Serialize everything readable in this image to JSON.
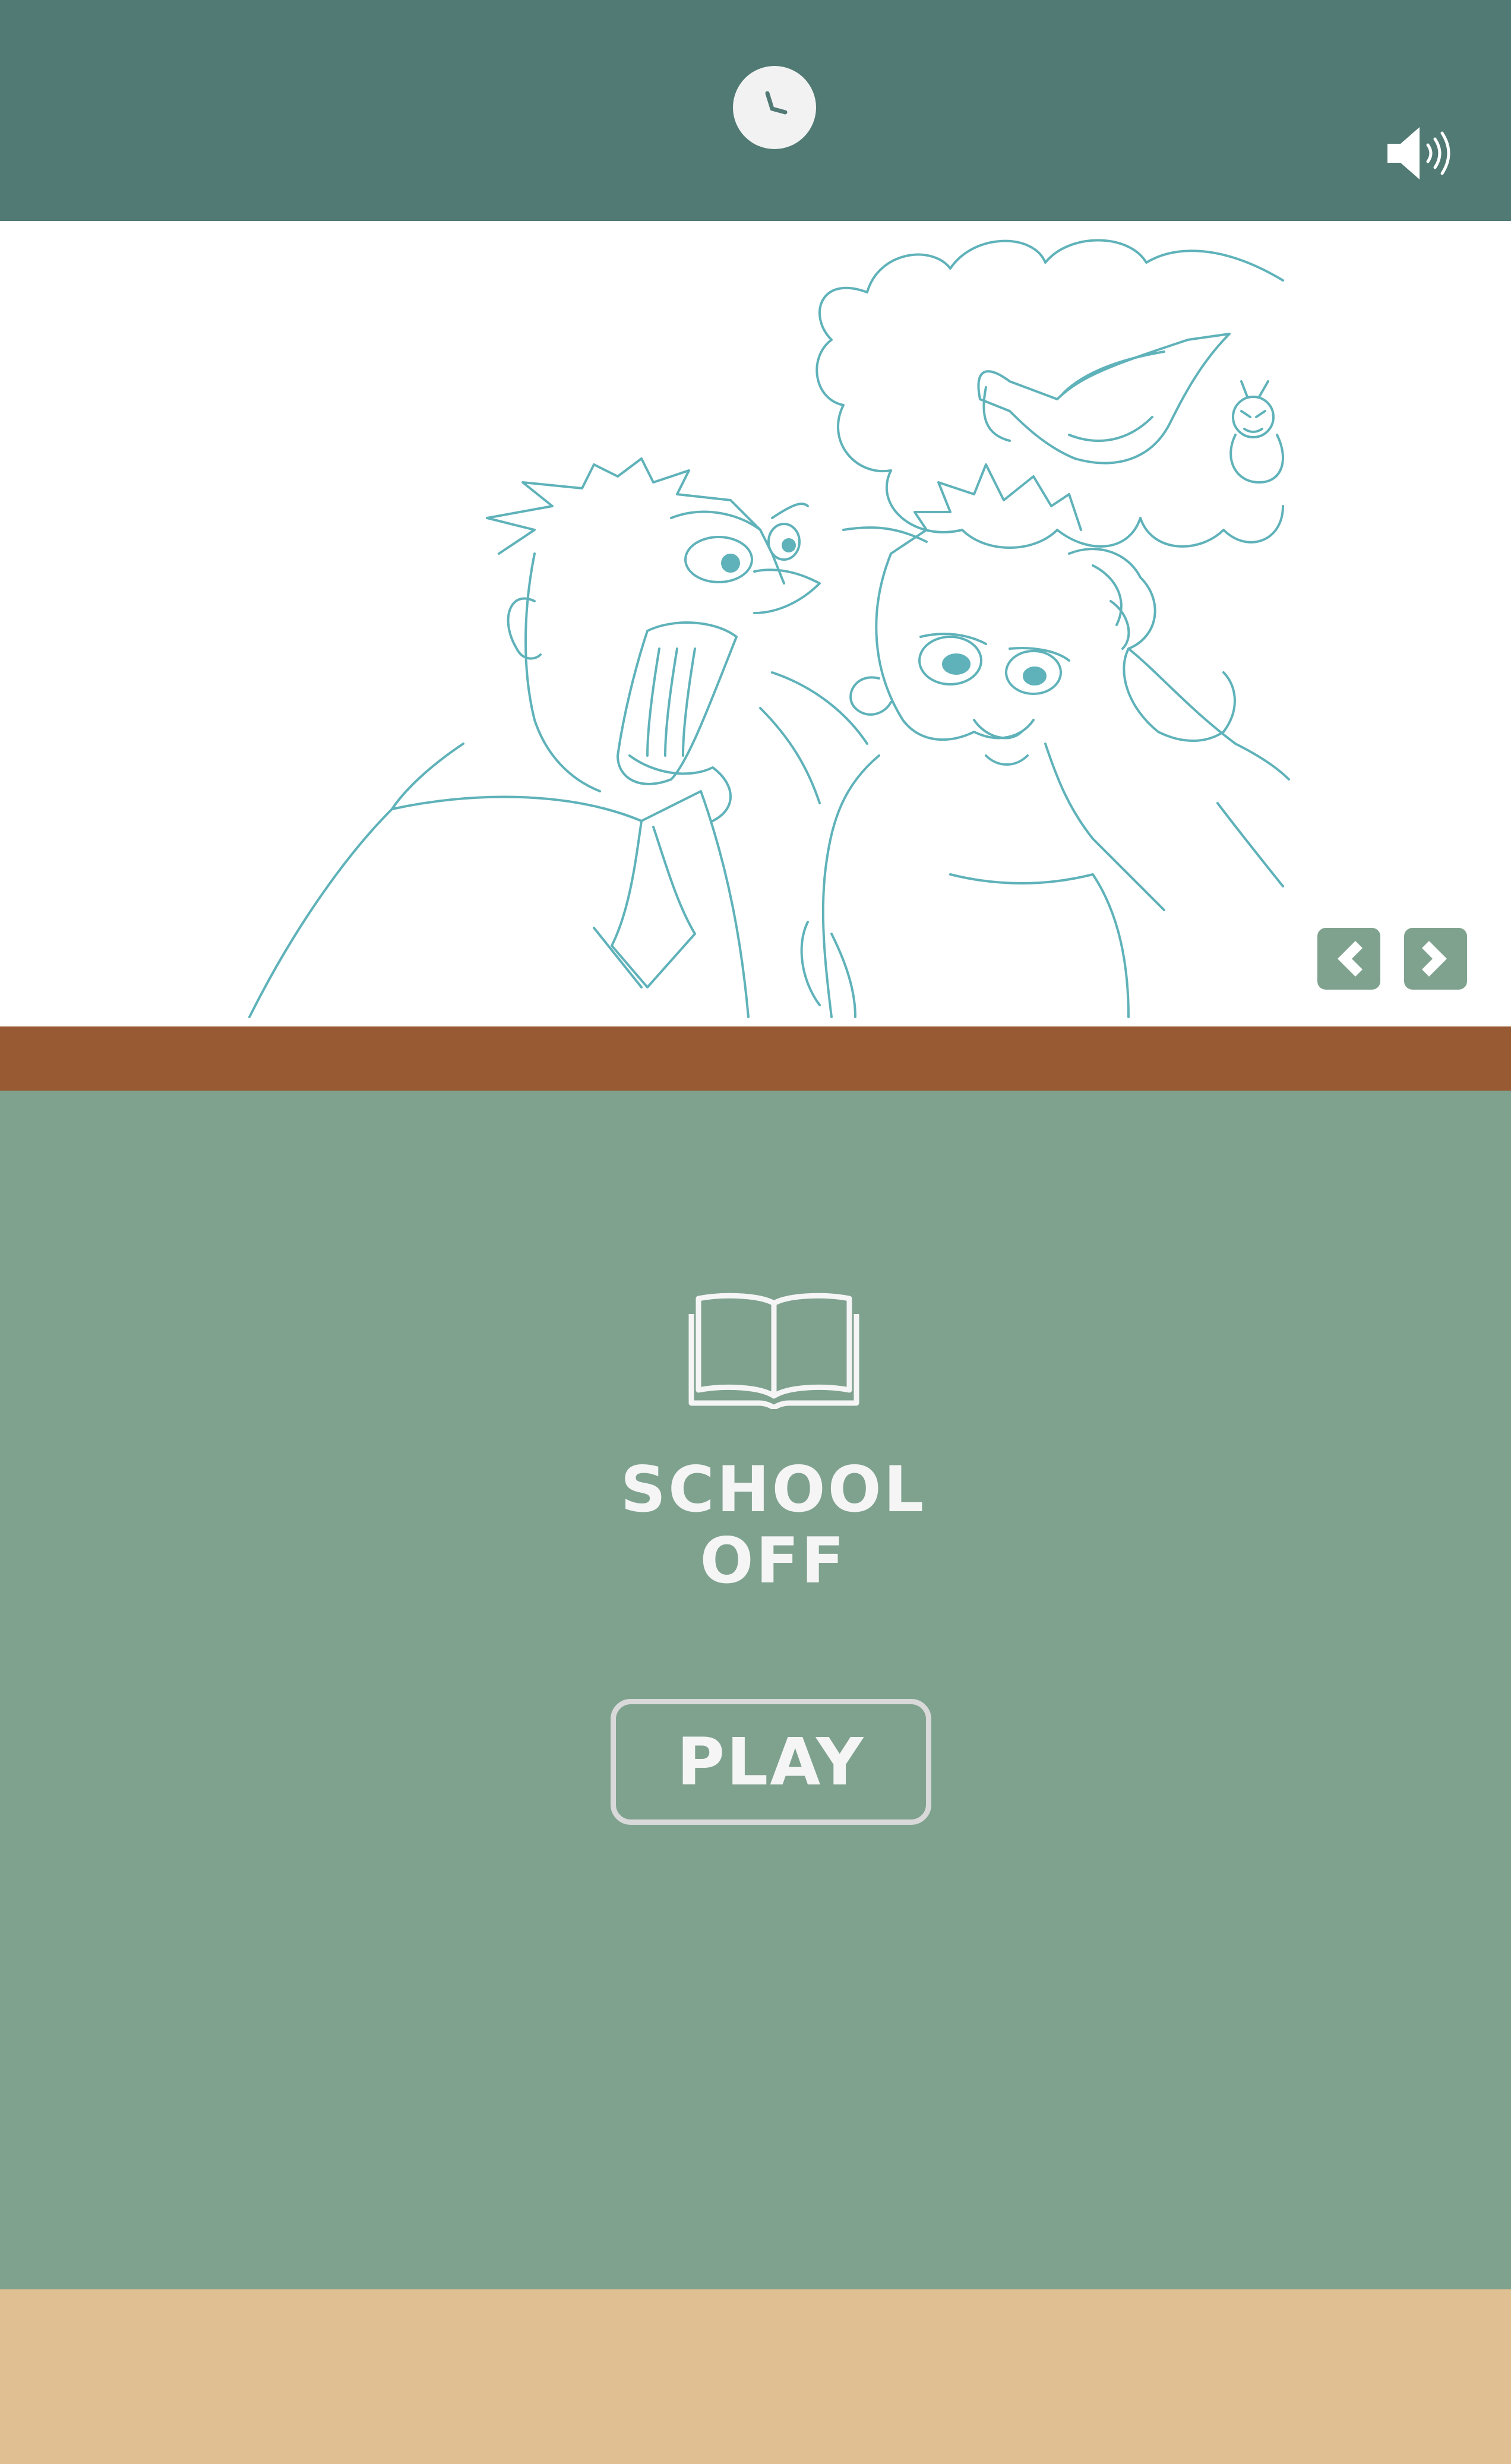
{
  "game": {
    "title_line1": "SCHOOL",
    "title_line2": "OFF",
    "play_label": "PLAY"
  },
  "header": {
    "timer_icon": "clock-icon",
    "sound_icon": "speaker-icon"
  },
  "scene": {
    "image": "cartoon-sketch-angry-teacher-yelling-at-boy",
    "prev_icon": "chevron-left-icon",
    "next_icon": "chevron-right-icon"
  },
  "panel": {
    "icon": "open-book-icon"
  },
  "colors": {
    "header": "#507a73",
    "panel": "#7fa28f",
    "shelf": "#975a32",
    "floor": "#e0c092",
    "sketch_line": "#5fb2b9",
    "text": "#f5f5f5"
  }
}
